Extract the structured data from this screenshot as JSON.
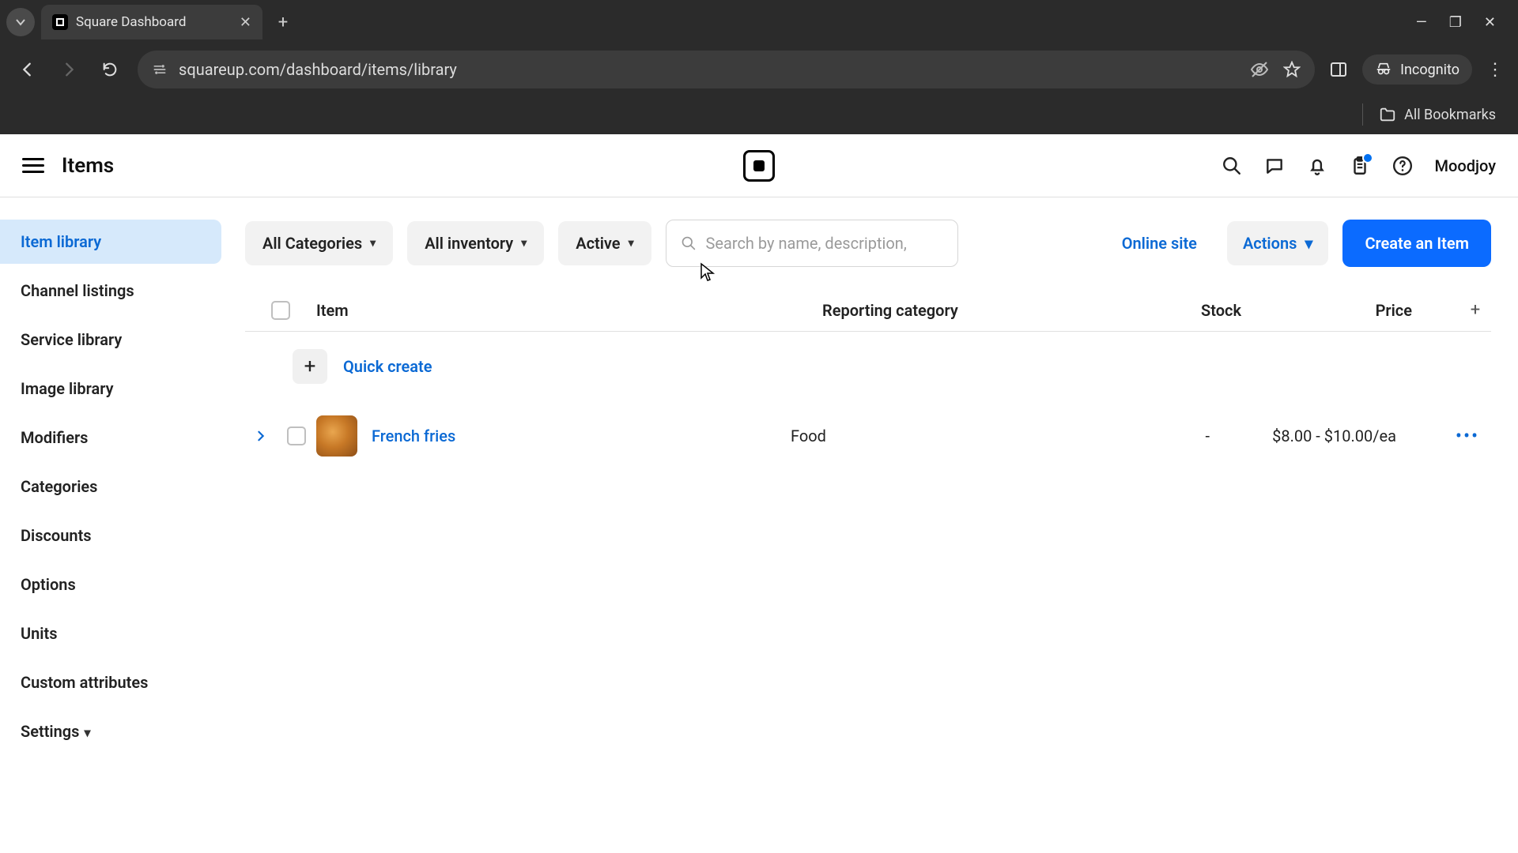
{
  "browser": {
    "tab_title": "Square Dashboard",
    "url": "squareup.com/dashboard/items/library",
    "incognito_label": "Incognito",
    "bookmarks_label": "All Bookmarks"
  },
  "header": {
    "page_title": "Items",
    "username": "Moodjoy"
  },
  "sidebar": {
    "items": [
      {
        "label": "Item library",
        "active": true
      },
      {
        "label": "Channel listings"
      },
      {
        "label": "Service library"
      },
      {
        "label": "Image library"
      },
      {
        "label": "Modifiers"
      },
      {
        "label": "Categories"
      },
      {
        "label": "Discounts"
      },
      {
        "label": "Options"
      },
      {
        "label": "Units"
      },
      {
        "label": "Custom attributes"
      },
      {
        "label": "Settings",
        "chevron": true
      }
    ]
  },
  "toolbar": {
    "filter_categories": "All Categories",
    "filter_inventory": "All inventory",
    "filter_status": "Active",
    "search_placeholder": "Search by name, description,",
    "online_site": "Online site",
    "actions": "Actions",
    "create": "Create an Item"
  },
  "table": {
    "headers": {
      "item": "Item",
      "category": "Reporting category",
      "stock": "Stock",
      "price": "Price"
    },
    "quick_create": "Quick create",
    "rows": [
      {
        "name": "French fries",
        "category": "Food",
        "stock": "-",
        "price": "$8.00 - $10.00/ea"
      }
    ]
  }
}
